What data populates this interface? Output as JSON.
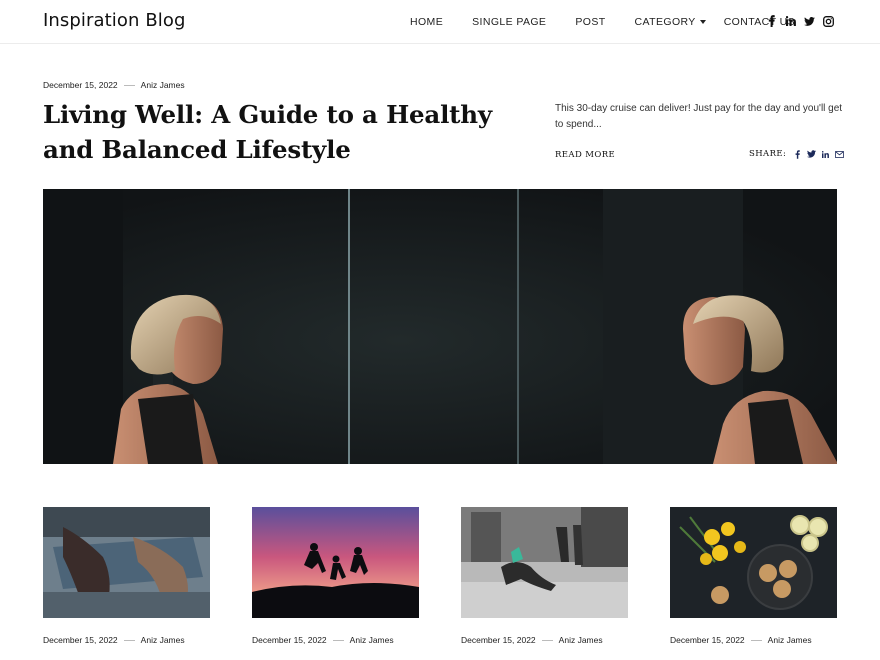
{
  "site": {
    "title": "Inspiration Blog"
  },
  "nav": {
    "items": [
      "HOME",
      "SINGLE PAGE",
      "POST",
      "CATEGORY",
      "CONTACT US"
    ]
  },
  "social": [
    "facebook-icon",
    "linkedin-icon",
    "twitter-icon",
    "instagram-icon"
  ],
  "hero": {
    "date": "December 15, 2022",
    "author": "Aniz James",
    "title": "Living Well: A Guide to a Healthy and Balanced Lifestyle",
    "excerpt": "This 30-day cruise can deliver! Just pay for the day and you'll get to spend...",
    "read_more": "READ MORE",
    "share_label": "SHARE:",
    "share_icons": [
      "facebook-icon",
      "twitter-icon",
      "linkedin-icon",
      "mail-icon"
    ]
  },
  "cards": [
    {
      "date": "December 15, 2022",
      "author": "Aniz James"
    },
    {
      "date": "December 15, 2022",
      "author": "Aniz James"
    },
    {
      "date": "December 15, 2022",
      "author": "Aniz James"
    },
    {
      "date": "December 15, 2022",
      "author": "Aniz James"
    }
  ],
  "colors": {
    "text": "#111111",
    "muted": "#333333",
    "rule": "#ececec",
    "hero_bg": "#15191b"
  }
}
